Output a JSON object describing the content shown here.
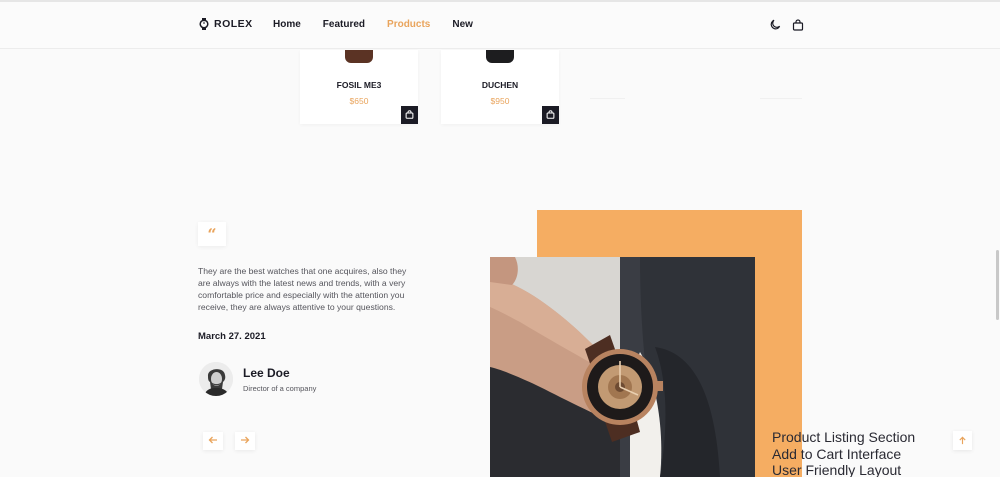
{
  "header": {
    "logo_text": "ROLEX",
    "nav": [
      {
        "label": "Home",
        "active": false
      },
      {
        "label": "Featured",
        "active": false
      },
      {
        "label": "Products",
        "active": true
      },
      {
        "label": "New",
        "active": false
      }
    ],
    "icons": [
      "moon-icon",
      "shopping-bag-icon"
    ]
  },
  "products": [
    {
      "name": "FOSIL ME3",
      "price": "$650",
      "strap_color": "#5b3324"
    },
    {
      "name": "DUCHEN",
      "price": "$950",
      "strap_color": "#1d1d1f"
    }
  ],
  "testimonial": {
    "quote_icon": "quote-icon",
    "text": "They are the best watches that one acquires, also they are always with the latest news and trends, with a very comfortable price and especially with the attention you receive, they are always attentive to your questions.",
    "date": "March 27. 2021",
    "author_name": "Lee Doe",
    "author_role": "Director of a company"
  },
  "overlay_text": {
    "line1": "Product Listing Section",
    "line2": "Add to Cart Interface",
    "line3": "User Friendly Layout"
  },
  "colors": {
    "accent": "#e9a45c",
    "dark": "#1b1b25",
    "orange_block": "#f5ad62"
  }
}
